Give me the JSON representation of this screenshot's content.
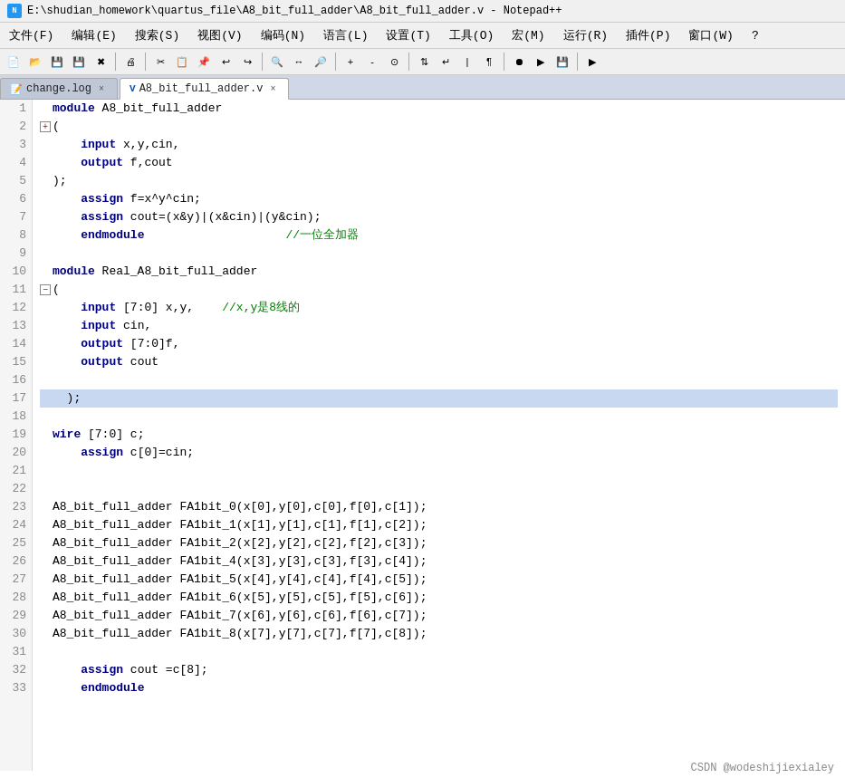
{
  "window": {
    "title": "E:\\shudian_homework\\quartus_file\\A8_bit_full_adder\\A8_bit_full_adder.v - Notepad++",
    "app_icon_label": "N++"
  },
  "menu": {
    "items": [
      "文件(F)",
      "编辑(E)",
      "搜索(S)",
      "视图(V)",
      "编码(N)",
      "语言(L)",
      "设置(T)",
      "工具(O)",
      "宏(M)",
      "运行(R)",
      "插件(P)",
      "窗口(W)",
      "?"
    ]
  },
  "tabs": [
    {
      "label": "change.log",
      "type": "log",
      "active": false
    },
    {
      "label": "A8_bit_full_adder.v",
      "type": "v",
      "active": true
    }
  ],
  "lines": [
    {
      "num": 1,
      "fold": null,
      "content": "module A8_bit_full_adder",
      "tokens": [
        {
          "t": "kw",
          "v": "module"
        },
        {
          "t": "ident",
          "v": " A8_bit_full_adder"
        }
      ]
    },
    {
      "num": 2,
      "fold": "close",
      "content": "(",
      "tokens": [
        {
          "t": "op",
          "v": "("
        }
      ]
    },
    {
      "num": 3,
      "fold": null,
      "content": "    input x,y,cin,",
      "tokens": [
        {
          "t": "indent",
          "v": "    "
        },
        {
          "t": "kw",
          "v": "input"
        },
        {
          "t": "ident",
          "v": " x,y,cin,"
        }
      ]
    },
    {
      "num": 4,
      "fold": null,
      "content": "    output f,cout",
      "tokens": [
        {
          "t": "indent",
          "v": "    "
        },
        {
          "t": "kw",
          "v": "output"
        },
        {
          "t": "ident",
          "v": " f,cout"
        }
      ]
    },
    {
      "num": 5,
      "fold": null,
      "content": ");",
      "tokens": [
        {
          "t": "op",
          "v": ");"
        }
      ]
    },
    {
      "num": 6,
      "fold": null,
      "content": "    assign f=x^y^cin;",
      "tokens": [
        {
          "t": "indent",
          "v": "    "
        },
        {
          "t": "kw",
          "v": "assign"
        },
        {
          "t": "ident",
          "v": " f=x^y^cin;"
        }
      ]
    },
    {
      "num": 7,
      "fold": null,
      "content": "    assign cout=(x&y)|(x&cin)|(y&cin);",
      "tokens": [
        {
          "t": "indent",
          "v": "    "
        },
        {
          "t": "kw",
          "v": "assign"
        },
        {
          "t": "ident",
          "v": " cout=(x&y)|(x&cin)|(y&cin);"
        }
      ]
    },
    {
      "num": 8,
      "fold": null,
      "content": "    endmodule                    //一位全加器",
      "tokens": [
        {
          "t": "indent",
          "v": "    "
        },
        {
          "t": "kw",
          "v": "endmodule"
        },
        {
          "t": "spaces",
          "v": "                    "
        },
        {
          "t": "cm",
          "v": "//一位全加器"
        }
      ]
    },
    {
      "num": 9,
      "fold": null,
      "content": "",
      "tokens": []
    },
    {
      "num": 10,
      "fold": null,
      "content": "module Real_A8_bit_full_adder",
      "tokens": [
        {
          "t": "kw",
          "v": "module"
        },
        {
          "t": "ident",
          "v": " Real_A8_bit_full_adder"
        }
      ]
    },
    {
      "num": 11,
      "fold": "open",
      "content": "(",
      "tokens": [
        {
          "t": "op",
          "v": "("
        }
      ]
    },
    {
      "num": 12,
      "fold": null,
      "content": "    input [7:0] x,y,    //x,y是8线的",
      "tokens": [
        {
          "t": "indent",
          "v": "    "
        },
        {
          "t": "kw",
          "v": "input"
        },
        {
          "t": "ident",
          "v": " [7:0] x,y,    "
        },
        {
          "t": "cm",
          "v": "//x,y是8线的"
        }
      ]
    },
    {
      "num": 13,
      "fold": null,
      "content": "    input cin,",
      "tokens": [
        {
          "t": "indent",
          "v": "    "
        },
        {
          "t": "kw",
          "v": "input"
        },
        {
          "t": "ident",
          "v": " cin,"
        }
      ]
    },
    {
      "num": 14,
      "fold": null,
      "content": "    output [7:0]f,",
      "tokens": [
        {
          "t": "indent",
          "v": "    "
        },
        {
          "t": "kw",
          "v": "output"
        },
        {
          "t": "ident",
          "v": " [7:0]f,"
        }
      ]
    },
    {
      "num": 15,
      "fold": null,
      "content": "    output cout",
      "tokens": [
        {
          "t": "indent",
          "v": "    "
        },
        {
          "t": "kw",
          "v": "output"
        },
        {
          "t": "ident",
          "v": " cout"
        }
      ]
    },
    {
      "num": 16,
      "fold": null,
      "content": "",
      "tokens": []
    },
    {
      "num": 17,
      "fold": null,
      "content": ");",
      "tokens": [
        {
          "t": "op",
          "v": "  );"
        }
      ],
      "highlighted": true
    },
    {
      "num": 18,
      "fold": null,
      "content": "",
      "tokens": []
    },
    {
      "num": 19,
      "fold": null,
      "content": "wire [7:0] c;",
      "tokens": [
        {
          "t": "kw",
          "v": "wire"
        },
        {
          "t": "ident",
          "v": " [7:0] c;"
        }
      ]
    },
    {
      "num": 20,
      "fold": null,
      "content": "    assign c[0]=cin;",
      "tokens": [
        {
          "t": "indent",
          "v": "    "
        },
        {
          "t": "kw",
          "v": "assign"
        },
        {
          "t": "ident",
          "v": " c[0]=cin;"
        }
      ]
    },
    {
      "num": 21,
      "fold": null,
      "content": "",
      "tokens": []
    },
    {
      "num": 22,
      "fold": null,
      "content": "",
      "tokens": []
    },
    {
      "num": 23,
      "fold": null,
      "content": "A8_bit_full_adder FA1bit_0(x[0],y[0],c[0],f[0],c[1]);",
      "tokens": [
        {
          "t": "ident",
          "v": "A8_bit_full_adder FA1bit_0(x[0],y[0],c[0],f[0],c[1]);"
        }
      ]
    },
    {
      "num": 24,
      "fold": null,
      "content": "A8_bit_full_adder FA1bit_1(x[1],y[1],c[1],f[1],c[2]);",
      "tokens": [
        {
          "t": "ident",
          "v": "A8_bit_full_adder FA1bit_1(x[1],y[1],c[1],f[1],c[2]);"
        }
      ]
    },
    {
      "num": 25,
      "fold": null,
      "content": "A8_bit_full_adder FA1bit_2(x[2],y[2],c[2],f[2],c[3]);",
      "tokens": [
        {
          "t": "ident",
          "v": "A8_bit_full_adder FA1bit_2(x[2],y[2],c[2],f[2],c[3]);"
        }
      ]
    },
    {
      "num": 26,
      "fold": null,
      "content": "A8_bit_full_adder FA1bit_4(x[3],y[3],c[3],f[3],c[4]);",
      "tokens": [
        {
          "t": "ident",
          "v": "A8_bit_full_adder FA1bit_4(x[3],y[3],c[3],f[3],c[4]);"
        }
      ]
    },
    {
      "num": 27,
      "fold": null,
      "content": "A8_bit_full_adder FA1bit_5(x[4],y[4],c[4],f[4],c[5]);",
      "tokens": [
        {
          "t": "ident",
          "v": "A8_bit_full_adder FA1bit_5(x[4],y[4],c[4],f[4],c[5]);"
        }
      ]
    },
    {
      "num": 28,
      "fold": null,
      "content": "A8_bit_full_adder FA1bit_6(x[5],y[5],c[5],f[5],c[6]);",
      "tokens": [
        {
          "t": "ident",
          "v": "A8_bit_full_adder FA1bit_6(x[5],y[5],c[5],f[5],c[6]);"
        }
      ]
    },
    {
      "num": 29,
      "fold": null,
      "content": "A8_bit_full_adder FA1bit_7(x[6],y[6],c[6],f[6],c[7]);",
      "tokens": [
        {
          "t": "ident",
          "v": "A8_bit_full_adder FA1bit_7(x[6],y[6],c[6],f[6],c[7]);"
        }
      ]
    },
    {
      "num": 30,
      "fold": null,
      "content": "A8_bit_full_adder FA1bit_8(x[7],y[7],c[7],f[7],c[8]);",
      "tokens": [
        {
          "t": "ident",
          "v": "A8_bit_full_adder FA1bit_8(x[7],y[7],c[7],f[7],c[8]);"
        }
      ]
    },
    {
      "num": 31,
      "fold": null,
      "content": "",
      "tokens": []
    },
    {
      "num": 32,
      "fold": null,
      "content": "    assign cout =c[8];",
      "tokens": [
        {
          "t": "indent",
          "v": "    "
        },
        {
          "t": "kw",
          "v": "assign"
        },
        {
          "t": "ident",
          "v": " cout =c[8];"
        }
      ]
    },
    {
      "num": 33,
      "fold": null,
      "content": "    endmodule",
      "tokens": [
        {
          "t": "indent",
          "v": "    "
        },
        {
          "t": "kw",
          "v": "endmodule"
        }
      ]
    }
  ],
  "watermark": {
    "text": "CSDN @wodeshijiexialey"
  },
  "toolbar_buttons": [
    "new",
    "open",
    "save",
    "save-all",
    "close",
    "|",
    "print",
    "|",
    "cut",
    "copy",
    "paste",
    "undo",
    "redo",
    "|",
    "find",
    "replace",
    "find-in-files",
    "|",
    "zoom-in",
    "zoom-out",
    "restore-zoom",
    "|",
    "sync-scroll",
    "word-wrap",
    "indent-guide",
    "view-all-chars",
    "|",
    "macro-record",
    "macro-playback",
    "macro-save",
    "|",
    "run"
  ]
}
